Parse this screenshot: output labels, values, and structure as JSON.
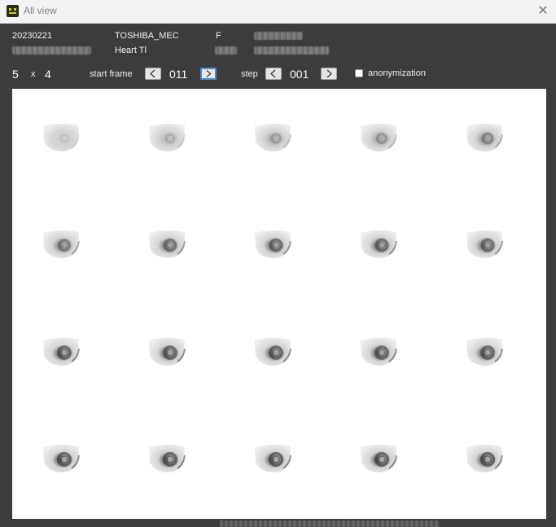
{
  "window": {
    "title": "All view",
    "icon": "smiley-app-icon",
    "close_icon": "close-icon"
  },
  "info": {
    "date": "20230221",
    "manufacturer": "TOSHIBA_MEC",
    "sex": "F",
    "study": "Heart Tl"
  },
  "controls": {
    "cols": "5",
    "times": "x",
    "rows": "4",
    "start_frame_label": "start frame",
    "start_frame_value": "011",
    "step_label": "step",
    "step_value": "001",
    "anonymization_label": "anonymization",
    "anonymization_checked": false
  },
  "grid": {
    "columns": 5,
    "rows": 4,
    "frames": [
      {
        "row": 0,
        "col": 0,
        "spot": 0.15
      },
      {
        "row": 0,
        "col": 1,
        "spot": 0.25
      },
      {
        "row": 0,
        "col": 2,
        "spot": 0.35
      },
      {
        "row": 0,
        "col": 3,
        "spot": 0.4
      },
      {
        "row": 0,
        "col": 4,
        "spot": 0.5
      },
      {
        "row": 1,
        "col": 0,
        "spot": 0.6
      },
      {
        "row": 1,
        "col": 1,
        "spot": 0.7
      },
      {
        "row": 1,
        "col": 2,
        "spot": 0.75
      },
      {
        "row": 1,
        "col": 3,
        "spot": 0.75
      },
      {
        "row": 1,
        "col": 4,
        "spot": 0.75
      },
      {
        "row": 2,
        "col": 0,
        "spot": 0.85
      },
      {
        "row": 2,
        "col": 1,
        "spot": 0.85
      },
      {
        "row": 2,
        "col": 2,
        "spot": 0.85
      },
      {
        "row": 2,
        "col": 3,
        "spot": 0.85
      },
      {
        "row": 2,
        "col": 4,
        "spot": 0.85
      },
      {
        "row": 3,
        "col": 0,
        "spot": 0.9
      },
      {
        "row": 3,
        "col": 1,
        "spot": 0.9
      },
      {
        "row": 3,
        "col": 2,
        "spot": 0.9
      },
      {
        "row": 3,
        "col": 3,
        "spot": 0.9
      },
      {
        "row": 3,
        "col": 4,
        "spot": 0.9
      }
    ]
  }
}
